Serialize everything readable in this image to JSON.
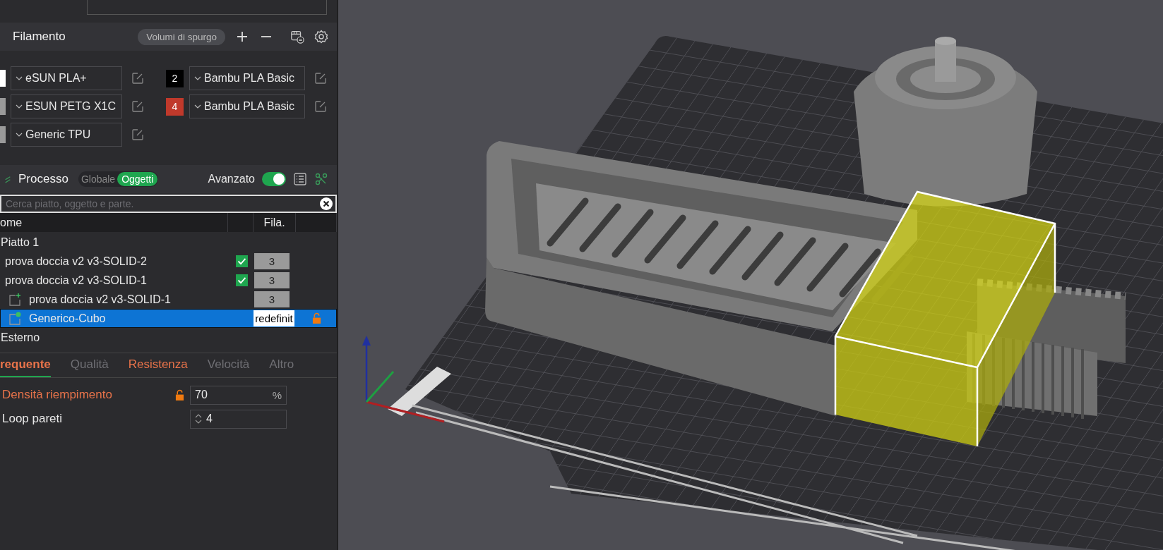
{
  "filament": {
    "title": "Filamento",
    "flush_button": "Volumi di spurgo",
    "slots": [
      {
        "kind": "swatch",
        "color": "#ffffff",
        "name": "eSUN PLA+"
      },
      {
        "kind": "badge",
        "badge": "2",
        "color": "#000000",
        "name": "Bambu PLA Basic"
      },
      {
        "kind": "swatch",
        "color": "#9a9a9a",
        "name": "ESUN PETG X1C"
      },
      {
        "kind": "badge",
        "badge": "4",
        "color": "#c0392b",
        "name": "Bambu PLA Basic"
      },
      {
        "kind": "swatch",
        "color": "#9a9a9a",
        "name": "Generic TPU"
      }
    ]
  },
  "process": {
    "title": "Processo",
    "scopes": [
      {
        "label": "Globale",
        "selected": false
      },
      {
        "label": "Oggetti",
        "selected": true
      }
    ],
    "advanced": {
      "label": "Avanzato",
      "on": true
    }
  },
  "search": {
    "placeholder": "Cerca piatto, oggetto e parte."
  },
  "tree": {
    "columns": [
      "ome",
      "Fila."
    ],
    "rows": [
      {
        "name": "Piatto 1",
        "selected": false,
        "children": [
          {
            "kind": "object",
            "name": "prova doccia v2 v3-SOLID-2",
            "selected": false,
            "checked": true,
            "filament": "3"
          },
          {
            "kind": "object",
            "name": "prova doccia v2 v3-SOLID-1",
            "selected": false,
            "checked": true,
            "filament": "3",
            "children": [
              {
                "kind": "part",
                "name": "prova doccia v2 v3-SOLID-1",
                "selected": false,
                "filament": "3"
              },
              {
                "kind": "modifier",
                "name": "Generico-Cubo",
                "selected": true,
                "filament": "redefinit",
                "locked": false
              }
            ]
          }
        ]
      },
      {
        "name": "Esterno",
        "selected": false
      }
    ]
  },
  "settings_tabs": [
    {
      "label": "requente",
      "selected": true,
      "modified": true
    },
    {
      "label": "Qualità",
      "selected": false,
      "modified": false
    },
    {
      "label": "Resistenza",
      "selected": false,
      "modified": true
    },
    {
      "label": "Velocità",
      "selected": false,
      "modified": false
    },
    {
      "label": "Altro",
      "selected": false,
      "modified": false
    }
  ],
  "params": [
    {
      "kind": "percent",
      "label": "Densità riempimento",
      "modified": true,
      "locked": false,
      "value": "70",
      "unit": "%"
    },
    {
      "kind": "spin",
      "label": "Loop pareti",
      "modified": false,
      "value": "4"
    }
  ]
}
